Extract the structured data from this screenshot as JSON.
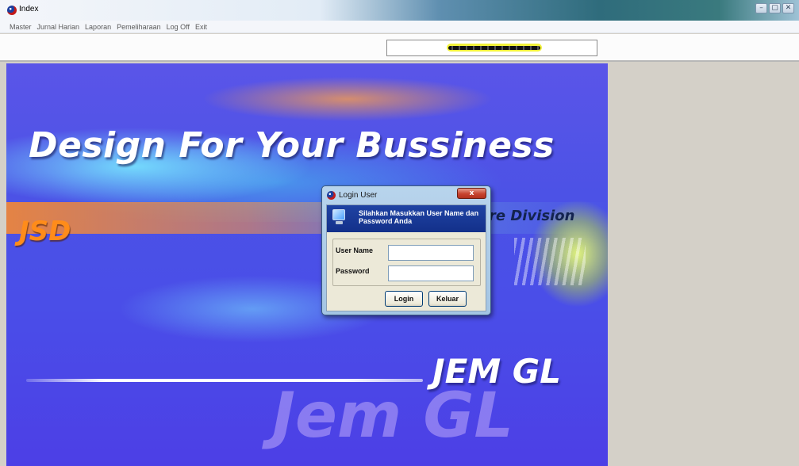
{
  "window": {
    "title": "Index",
    "controls": [
      "–",
      "▢",
      "✕"
    ]
  },
  "menu": [
    "Master",
    "Jurnal Harian",
    "Laporan",
    "Pemeliharaan",
    "Log Off",
    "Exit"
  ],
  "splash": {
    "headline": "Design For Your Bussiness",
    "left_tag": "JSD",
    "division_text": "re Division",
    "product": "JEM GL",
    "product_large": "Jem GL"
  },
  "login_dialog": {
    "title": "Login User",
    "close_label": "x",
    "message": "Silahkan Masukkan User Name dan Password Anda",
    "username_label": "User Name",
    "username_value": "",
    "password_label": "Password",
    "password_value": "",
    "login_button": "Login",
    "keluar_button": "Keluar"
  },
  "colors": {
    "splash_blue": "#4a4ee8",
    "dialog_banner": "#1f43a3",
    "jsd_orange": "#ff8c1a",
    "status_highlight": "#f2f23a"
  },
  "icons": {
    "app": "app-logo-icon",
    "dialog": "app-logo-icon",
    "banner": "computer-icon"
  }
}
